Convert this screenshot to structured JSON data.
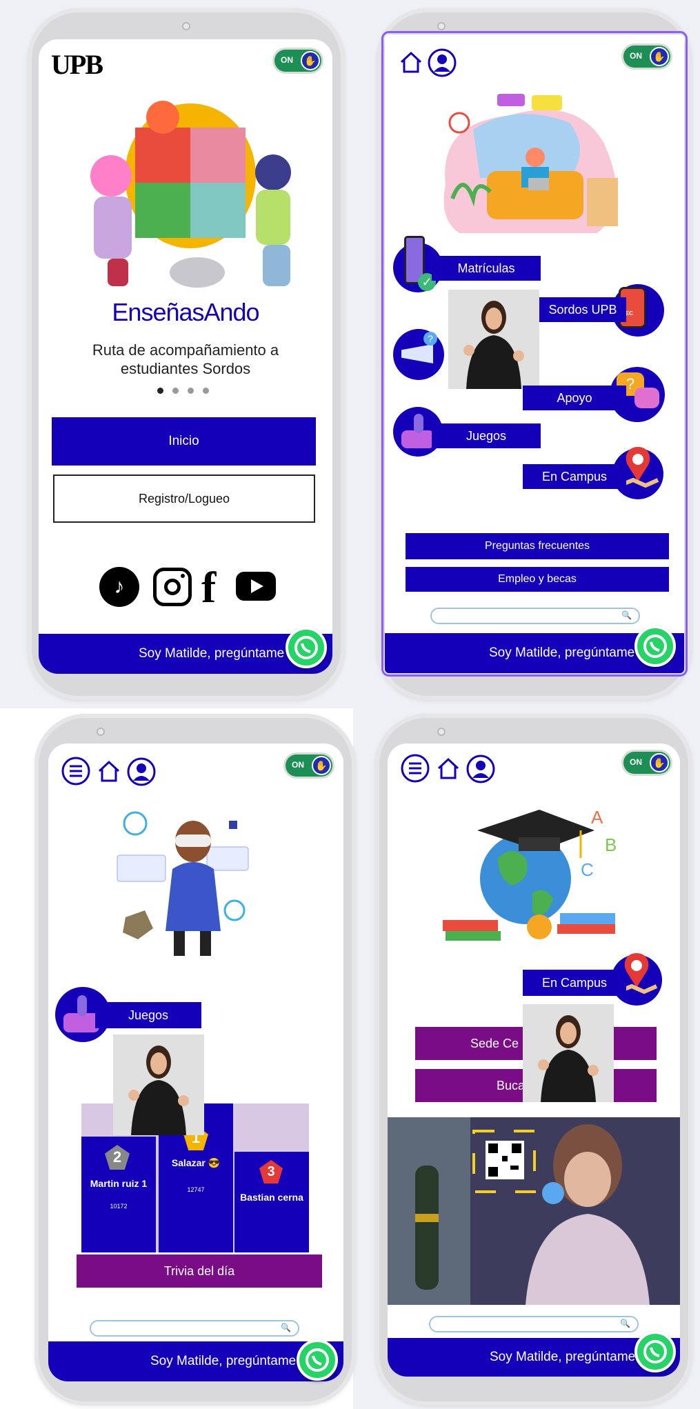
{
  "colors": {
    "primary": "#1400b8",
    "secondary": "#7a0c86",
    "toggle": "#1d8f55",
    "whatsapp": "#25d366",
    "frame": "#8b5cf6"
  },
  "common": {
    "toggle_label": "ON",
    "chat_label": "Soy Matilde, pregúntame",
    "icons": [
      "home-icon",
      "user-icon",
      "menu-icon",
      "search-icon",
      "whatsapp-icon",
      "sign-language-icon"
    ]
  },
  "screen1": {
    "logo": "UPB",
    "title": "EnseñasAndo",
    "subtitle": "Ruta de acompañamiento a estudiantes Sordos",
    "carousel_dots": 4,
    "inicio_label": "Inicio",
    "registro_label": "Registro/Logueo",
    "social": [
      "tiktok-icon",
      "instagram-icon",
      "facebook-icon",
      "youtube-icon"
    ],
    "social_f": "f"
  },
  "screen2": {
    "menu": {
      "matriculas": "Matrículas",
      "sordos": "Sordos UPB",
      "apoyo": "Apoyo",
      "juegos": "Juegos",
      "campus": "En Campus"
    },
    "rec_label": "REC",
    "faq_label": "Preguntas frecuentes",
    "empleo_label": "Empleo y becas"
  },
  "screen3": {
    "juegos_label": "Juegos",
    "podium": [
      {
        "rank": "2",
        "name": "Martin ruiz 1",
        "score": "10172"
      },
      {
        "rank": "1",
        "name": "Salazar 😎",
        "score": "12747"
      },
      {
        "rank": "3",
        "name": "Bastian cerna",
        "score": ""
      }
    ],
    "trivia_label": "Trivia del día"
  },
  "screen4": {
    "campus_label": "En Campus",
    "sede_label": "Sede Ce",
    "buscar_label": "Buca",
    "letters": [
      "A",
      "B",
      "C"
    ]
  }
}
